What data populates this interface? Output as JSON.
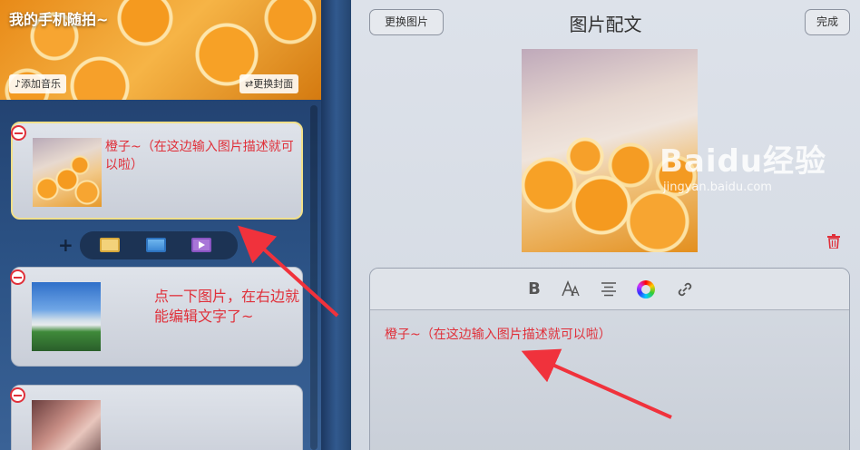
{
  "left_panel": {
    "cover": {
      "title": "我的手机随拍~",
      "add_music_label": "♪添加音乐",
      "change_cover_label": "⇄更换封面"
    },
    "cards": [
      {
        "text": "橙子~（在这边输入图片描述就可以啦）",
        "selected": true,
        "thumbnail": "oranges"
      },
      {
        "text": "",
        "selected": false,
        "thumbnail": "city"
      },
      {
        "text": "",
        "selected": false,
        "thumbnail": "hand"
      }
    ],
    "insert_bar": {
      "plus_icon": "plus-icon",
      "icons": [
        "text-icon",
        "image-icon",
        "video-icon"
      ]
    },
    "annotation": "点一下图片，在右边就能编辑文字了~"
  },
  "right_panel": {
    "title": "图片配文",
    "change_image_label": "更换图片",
    "done_label": "完成",
    "editor": {
      "toolbar": [
        "bold-icon",
        "font-size-icon",
        "align-icon",
        "color-icon",
        "link-icon"
      ],
      "bold_label": "B",
      "text": "橙子~（在这边输入图片描述就可以啦）"
    }
  },
  "watermark": {
    "main": "Baidu经验",
    "sub": "jingyan.baidu.com"
  },
  "colors": {
    "accent_red": "#e0303a",
    "selected_border": "#f1e08a",
    "panel_blue": "#2c5386"
  }
}
